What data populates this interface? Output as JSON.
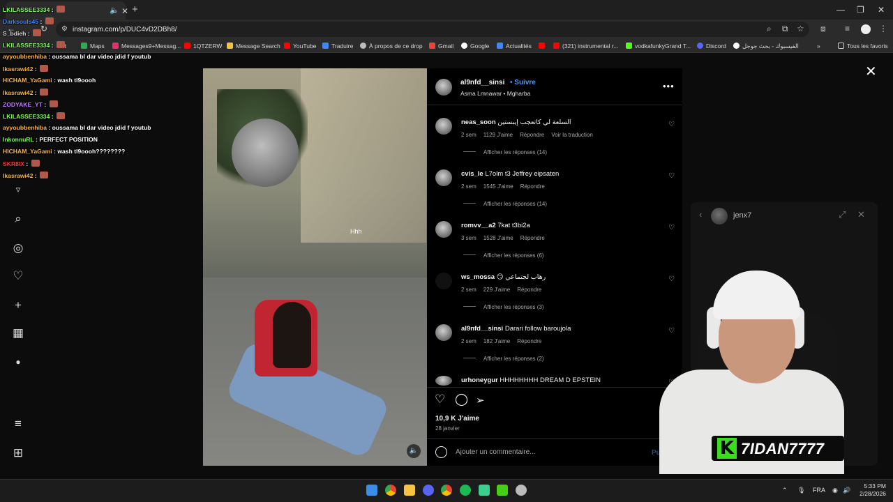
{
  "browser": {
    "url": "instagram.com/p/DUC4vD2DBh8/",
    "bookmarks": [
      "Maps",
      "Messages9+Messag...",
      "1QTZERW",
      "Message Search",
      "YouTube",
      "Traduire",
      "À propos de ce drop",
      "Gmail",
      "Google",
      "Actualités",
      "(321) instrumental r...",
      "vodkafunkyGrand T...",
      "Discord",
      "الفيسبوك - بحث جوجل",
      "Tous les favoris"
    ],
    "tab_partial": "et"
  },
  "chat": [
    {
      "user": "LKILASSEE3334",
      "msg": "",
      "color": "#7dff5a",
      "emote": true
    },
    {
      "user": "Darksouls45",
      "msg": "",
      "color": "#3e8bff",
      "emote": true
    },
    {
      "user": "S_bdieh",
      "msg": "",
      "color": "#dddddd",
      "emote": true
    },
    {
      "user": "LKILASSEE3334",
      "msg": "",
      "color": "#7dff5a",
      "emote": true
    },
    {
      "user": "ayyoubbenhiba",
      "msg": "oussama bl dar video jdid f youtub",
      "color": "#ffb347",
      "emote": false
    },
    {
      "user": "Ikasrawi42",
      "msg": "",
      "color": "#ffb347",
      "emote": true
    },
    {
      "user": "HICHAM_YaGami",
      "msg": "wash tl9oooh",
      "color": "#ffb347",
      "emote": false
    },
    {
      "user": "Ikasrawi42",
      "msg": "",
      "color": "#ffb347",
      "emote": true
    },
    {
      "user": "ZODYAKE_YT",
      "msg": "",
      "color": "#c37bff",
      "emote": true
    },
    {
      "user": "LKILASSEE3334",
      "msg": "",
      "color": "#7dff5a",
      "emote": true
    },
    {
      "user": "ayyoubbenhiba",
      "msg": "oussama bl dar video jdid f youtub",
      "color": "#ffb347",
      "emote": false
    },
    {
      "user": "InkonnuRL",
      "msg": "PERFECT POSITION",
      "color": "#7dff5a",
      "emote": false
    },
    {
      "user": "HICHAM_YaGami",
      "msg": "wash tl9oooh????????",
      "color": "#ffb347",
      "emote": false
    },
    {
      "user": "SKR8IX",
      "msg": "",
      "color": "#ff3b3b",
      "emote": true
    },
    {
      "user": "Ikasrawi42",
      "msg": "",
      "color": "#ffb347",
      "emote": true
    }
  ],
  "post": {
    "username": "al9nfd__sinsi",
    "follow_label": "Suivre",
    "subtitle": "Asma Lmnawar • Mgharba",
    "video_text": "Hhh",
    "likes": "10,9 K J'aime",
    "date": "28 janvier",
    "comment_placeholder": "Ajouter un commentaire...",
    "publish_label": "Publier"
  },
  "comments": [
    {
      "user": "neas_soon",
      "text": "السلعة لي كاتعجب إيبستين",
      "age": "2 sem",
      "likes": "1129 J'aime",
      "reply": "Répondre",
      "extra": "Voir la traduction",
      "replies": "Afficher les réponses (14)"
    },
    {
      "user": "cvis_le",
      "text": "L7olm t3 Jeffrey eipsaten",
      "age": "2 sem",
      "likes": "1545 J'aime",
      "reply": "Répondre",
      "extra": "",
      "replies": "Afficher les réponses (14)"
    },
    {
      "user": "romvv__a2",
      "text": "7kat t3bi2a",
      "age": "3 sem",
      "likes": "1528 J'aime",
      "reply": "Répondre",
      "extra": "",
      "replies": "Afficher les réponses (6)"
    },
    {
      "user": "ws_mossa",
      "text": "😏 رهاب لجتماعي",
      "age": "2 sem",
      "likes": "229 J'aime",
      "reply": "Répondre",
      "extra": "",
      "replies": "Afficher les réponses (3)"
    },
    {
      "user": "al9nfd__sinsi",
      "text": "Darari follow baroujola",
      "age": "2 sem",
      "likes": "182 J'aime",
      "reply": "Répondre",
      "extra": "",
      "replies": "Afficher les réponses (2)"
    },
    {
      "user": "urhoneygur",
      "text": "HHHHHHHH DREAM D EPSTEIN",
      "age": "",
      "likes": "",
      "reply": "",
      "extra": "",
      "replies": ""
    }
  ],
  "mini_window": {
    "name": "jenx7"
  },
  "overlay": {
    "streamer": "7IDAN7777",
    "logo": "K"
  },
  "taskbar": {
    "lang": "FRA",
    "time": "5:33 PM",
    "date": "2/28/2026"
  }
}
